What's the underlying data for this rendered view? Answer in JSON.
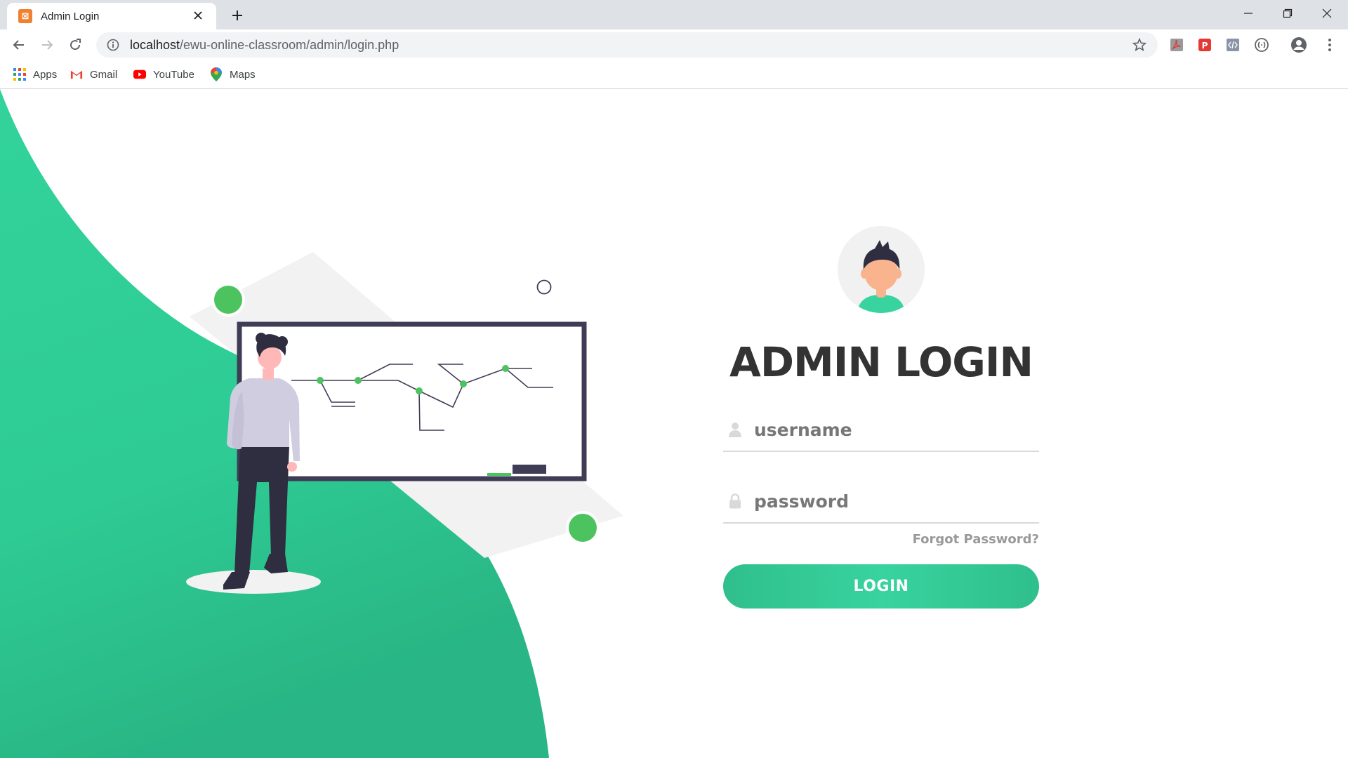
{
  "browser": {
    "tab_title": "Admin Login",
    "url_host": "localhost",
    "url_path": "/ewu-online-classroom/admin/login.php",
    "bookmarks": [
      "Apps",
      "Gmail",
      "YouTube",
      "Maps"
    ]
  },
  "login": {
    "title": "ADMIN LOGIN",
    "username_placeholder": "username",
    "password_placeholder": "password",
    "forgot_label": "Forgot Password?",
    "button_label": "LOGIN"
  },
  "colors": {
    "accent": "#38d39f",
    "accent_dark": "#2fbf8c",
    "dot_green": "#4cc35f",
    "title": "#333333",
    "board_frame": "#3f3d56"
  },
  "icons": [
    "xampp-favicon-icon",
    "close-icon",
    "plus-icon",
    "minimize-icon",
    "restore-icon",
    "back-icon",
    "forward-icon",
    "reload-icon",
    "info-icon",
    "star-icon",
    "pdf-extension-icon",
    "p-extension-icon",
    "code-extension-icon",
    "dots-extension-icon",
    "account-icon",
    "menu-icon",
    "apps-grid-icon",
    "gmail-icon",
    "youtube-icon",
    "maps-pin-icon",
    "user-icon",
    "lock-icon"
  ]
}
